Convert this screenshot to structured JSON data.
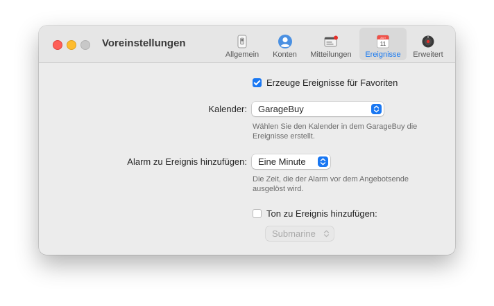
{
  "window": {
    "title": "Voreinstellungen"
  },
  "toolbar": {
    "tabs": [
      {
        "label": "Allgemein",
        "icon": "switch-icon"
      },
      {
        "label": "Konten",
        "icon": "person-icon"
      },
      {
        "label": "Mitteilungen",
        "icon": "notifications-icon"
      },
      {
        "label": "Ereignisse",
        "icon": "calendar-icon",
        "calendar_month": "JULY",
        "calendar_day": "11",
        "active": true
      },
      {
        "label": "Erweitert",
        "icon": "advanced-icon"
      }
    ]
  },
  "events": {
    "create_events_checkbox": {
      "label": "Erzeuge Ereignisse für Favoriten",
      "checked": true
    },
    "calendar": {
      "label": "Kalender:",
      "value": "GarageBuy",
      "help": "Wählen Sie den Kalender in dem GarageBuy die Ereignisse erstellt."
    },
    "alarm": {
      "label": "Alarm zu Ereignis hinzufügen:",
      "value": "Eine Minute",
      "help": "Die Zeit, die der Alarm vor dem Angebotsende ausgelöst wird."
    },
    "sound_checkbox": {
      "label": "Ton zu Ereignis hinzufügen:",
      "checked": false
    },
    "sound": {
      "value": "Submarine",
      "enabled": false
    }
  },
  "colors": {
    "accent": "#1977f2",
    "close": "#fe5f57",
    "minimize": "#febc2e"
  }
}
